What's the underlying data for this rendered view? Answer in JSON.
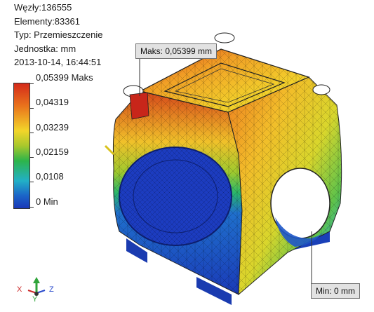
{
  "info": {
    "nodes": "Węzły:136555",
    "elements": "Elementy:83361",
    "type": "Typ: Przemieszczenie",
    "unit": "Jednostka: mm",
    "datetime": "2013-10-14, 16:44:51"
  },
  "legend": {
    "labels": [
      "0,05399 Maks",
      "0,04319",
      "0,03239",
      "0,02159",
      "0,0108",
      "0 Min"
    ],
    "colors": [
      "#d42a1a",
      "#e9731c",
      "#f2d52a",
      "#a8c82c",
      "#2db44a",
      "#22b0c6",
      "#1b64c8",
      "#1a38b8"
    ]
  },
  "callouts": {
    "max": "Maks: 0,05399 mm",
    "min": "Min: 0 mm"
  },
  "triad": {
    "x": "X",
    "y": "Y",
    "z": "Z"
  }
}
